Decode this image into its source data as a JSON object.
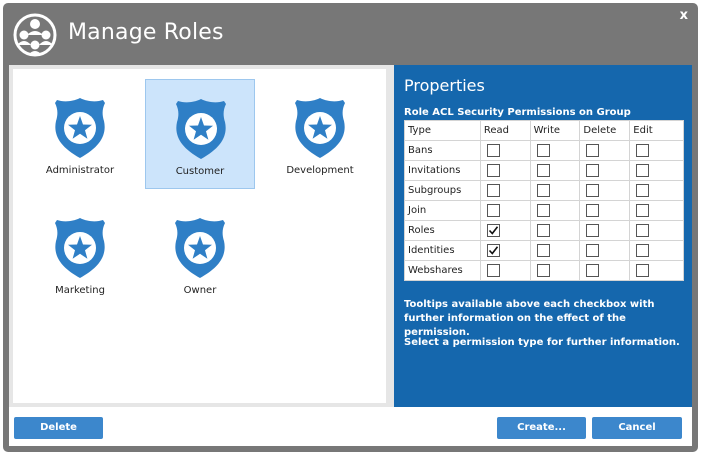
{
  "dialog": {
    "title": "Manage Roles",
    "close_label": "x",
    "title_icon": "users-group-icon"
  },
  "roles": [
    {
      "label": "Administrator",
      "icon": "shield-star-icon",
      "selected": false
    },
    {
      "label": "Customer",
      "icon": "shield-star-icon",
      "selected": true
    },
    {
      "label": "Development",
      "icon": "shield-star-icon",
      "selected": false
    },
    {
      "label": "Marketing",
      "icon": "shield-star-icon",
      "selected": false
    },
    {
      "label": "Owner",
      "icon": "shield-star-icon",
      "selected": false
    }
  ],
  "properties": {
    "title": "Properties",
    "subtitle": "Role ACL Security Permissions on Group",
    "columns": [
      "Type",
      "Read",
      "Write",
      "Delete",
      "Edit"
    ],
    "rows": [
      {
        "type": "Bans",
        "read": false,
        "write": false,
        "delete": false,
        "edit": false
      },
      {
        "type": "Invitations",
        "read": false,
        "write": false,
        "delete": false,
        "edit": false
      },
      {
        "type": "Subgroups",
        "read": false,
        "write": false,
        "delete": false,
        "edit": false
      },
      {
        "type": "Join",
        "read": false,
        "write": false,
        "delete": false,
        "edit": false
      },
      {
        "type": "Roles",
        "read": true,
        "write": false,
        "delete": false,
        "edit": false
      },
      {
        "type": "Identities",
        "read": true,
        "write": false,
        "delete": false,
        "edit": false
      },
      {
        "type": "Webshares",
        "read": false,
        "write": false,
        "delete": false,
        "edit": false
      }
    ],
    "help_text": "Tooltips available above each checkbox with further information on the effect of the permission.",
    "help_text2": "Select a permission type for further information."
  },
  "footer": {
    "delete_label": "Delete",
    "create_label": "Create...",
    "cancel_label": "Cancel"
  },
  "colors": {
    "titlebar": "#777777",
    "properties_panel": "#1567ad",
    "button": "#3c87cc",
    "badge": "#2f7fc6",
    "selected_tile": "#cce4fb"
  }
}
